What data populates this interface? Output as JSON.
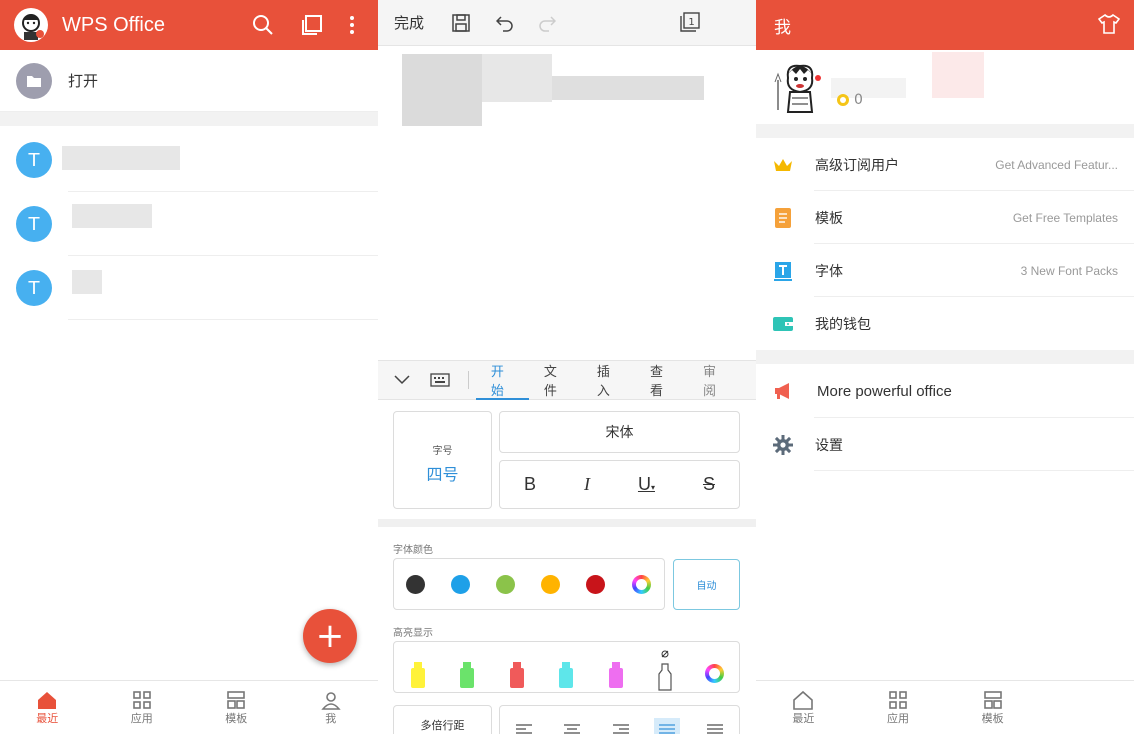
{
  "recent_panel": {
    "app_title": "WPS Office",
    "open_label": "打开",
    "file_badge": "T",
    "nav": [
      {
        "label": "最近"
      },
      {
        "label": "应用"
      },
      {
        "label": "模板"
      },
      {
        "label": "我"
      }
    ],
    "fab_symbol": "+"
  },
  "editor_panel": {
    "done_label": "完成",
    "page_count": "1",
    "tabs": [
      "开始",
      "文件",
      "插入",
      "查看",
      "审阅"
    ],
    "font_size_title": "字号",
    "font_size_value": "四号",
    "font_name": "宋体",
    "format_buttons": [
      "B",
      "I",
      "U",
      "S"
    ],
    "font_color_label": "字体颜色",
    "auto_label": "自动",
    "highlight_label": "高亮显示",
    "line_spacing_label": "多倍行距",
    "font_colors": [
      "#333333",
      "#1ea0e8",
      "#8bc34a",
      "#ffb300",
      "#c8141a"
    ],
    "highlight_colors": [
      "#fff23a",
      "#6be36b",
      "#f05a5a",
      "#5ee6ea",
      "#ee6ef0"
    ]
  },
  "me_panel": {
    "title": "我",
    "coins": "0",
    "menu": [
      {
        "label": "高级订阅用户",
        "detail": "Get Advanced Featur..."
      },
      {
        "label": "模板",
        "detail": "Get Free Templates"
      },
      {
        "label": "字体",
        "detail": "3 New Font Packs"
      },
      {
        "label": "我的钱包",
        "detail": ""
      }
    ],
    "more_label": "More powerful office",
    "settings_label": "设置",
    "nav": [
      {
        "label": "最近"
      },
      {
        "label": "应用"
      },
      {
        "label": "模板"
      }
    ]
  },
  "colors": {
    "brand": "#e8513a",
    "accent_blue": "#2f8fd8",
    "file_blue": "#47b0f0"
  }
}
